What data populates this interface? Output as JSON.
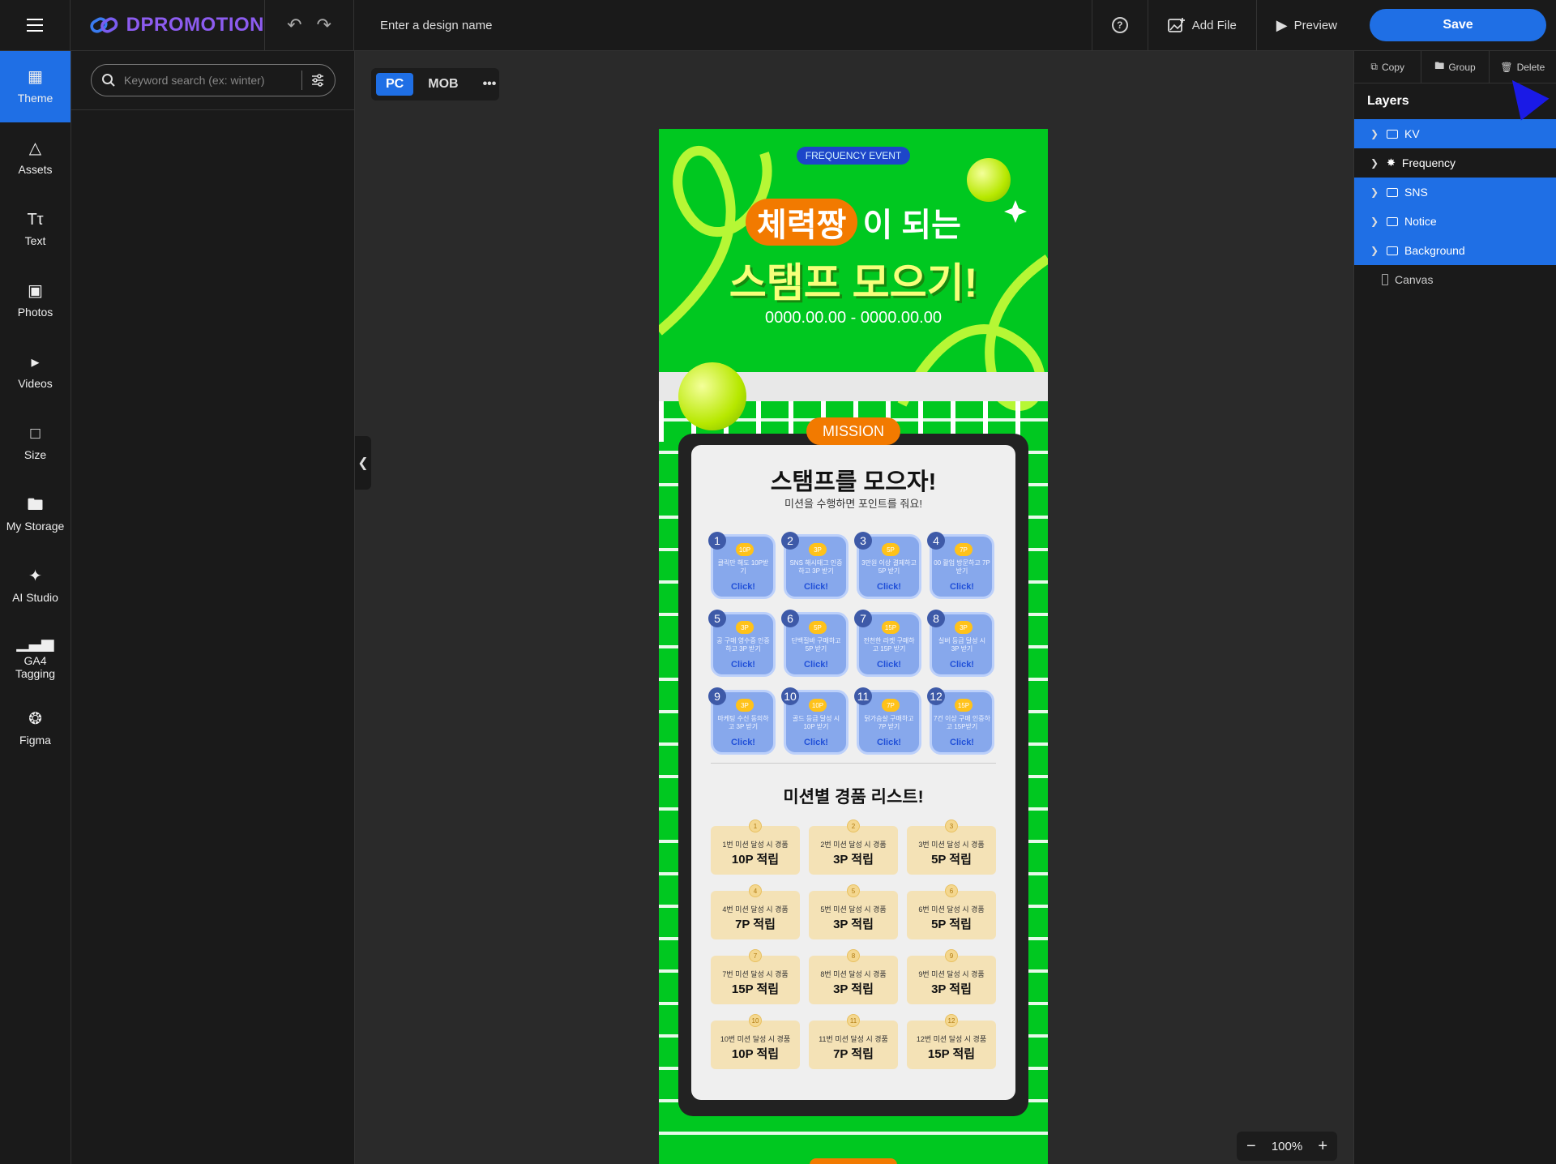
{
  "app": {
    "brand": "DPROMOTION",
    "design_name_placeholder": "Enter a design name"
  },
  "topbar": {
    "add_file": "Add File",
    "preview": "Preview",
    "save": "Save",
    "help_icon": "help-circle-icon"
  },
  "rail": {
    "items": [
      {
        "label": "Theme",
        "icon": "theme-icon",
        "active": true
      },
      {
        "label": "Assets",
        "icon": "assets-icon"
      },
      {
        "label": "Text",
        "icon": "text-icon"
      },
      {
        "label": "Photos",
        "icon": "photos-icon"
      },
      {
        "label": "Videos",
        "icon": "videos-icon"
      },
      {
        "label": "Size",
        "icon": "size-icon"
      },
      {
        "label": "My Storage",
        "icon": "folder-icon"
      },
      {
        "label": "AI Studio",
        "icon": "magic-wand-icon"
      },
      {
        "label": "GA4 Tagging",
        "icon": "bar-chart-icon"
      },
      {
        "label": "Figma",
        "icon": "figma-icon"
      }
    ]
  },
  "panel": {
    "search_placeholder": "Keyword search (ex: winter)"
  },
  "device": {
    "pc": "PC",
    "mob": "MOB"
  },
  "canvas": {
    "badge": "FREQUENCY EVENT",
    "title_highlight": "체력짱",
    "title_rest": "이 되는",
    "title_line2": "스탬프 모으기!",
    "date": "0000.00.00 - 0000.00.00",
    "mission_tag": "MISSION",
    "board_title": "스탬프를 모으자!",
    "board_subtitle": "미션을 수행하면 포인트를 줘요!",
    "stamps": [
      {
        "num": "1",
        "points": "10P",
        "desc": "클릭만 해도 10P받기",
        "click": "Click!"
      },
      {
        "num": "2",
        "points": "3P",
        "desc": "SNS 해시태그 인증하고 3P 받기",
        "click": "Click!"
      },
      {
        "num": "3",
        "points": "5P",
        "desc": "3만원 이상 결제하고 5P 받기",
        "click": "Click!"
      },
      {
        "num": "4",
        "points": "7P",
        "desc": "00 활업 방문하고 7P 받기",
        "click": "Click!"
      },
      {
        "num": "5",
        "points": "3P",
        "desc": "공 구매 영수증 인증하고 3P 받기",
        "click": "Click!"
      },
      {
        "num": "6",
        "points": "5P",
        "desc": "단백질바 구매하고 5P 받기",
        "click": "Click!"
      },
      {
        "num": "7",
        "points": "15P",
        "desc": "전천한 라켓 구매하고 15P 받기",
        "click": "Click!"
      },
      {
        "num": "8",
        "points": "3P",
        "desc": "실버 등급 달성 시 3P 받기",
        "click": "Click!"
      },
      {
        "num": "9",
        "points": "3P",
        "desc": "마케팅 수신 동의하고 3P 받기",
        "click": "Click!"
      },
      {
        "num": "10",
        "points": "10P",
        "desc": "골드 등급 달성 시 10P 받기",
        "click": "Click!"
      },
      {
        "num": "11",
        "points": "7P",
        "desc": "닭가슴살 구매하고 7P 받기",
        "click": "Click!"
      },
      {
        "num": "12",
        "points": "15P",
        "desc": "7건 이상 구매 인증하고 15P받기",
        "click": "Click!"
      }
    ],
    "prize_title": "미션별 경품 리스트!",
    "prizes": [
      {
        "num": "1",
        "cond": "1번 미션 달성 시 경품",
        "reward": "10P 적립"
      },
      {
        "num": "2",
        "cond": "2번 미션 달성 시 경품",
        "reward": "3P 적립"
      },
      {
        "num": "3",
        "cond": "3번 미션 달성 시 경품",
        "reward": "5P 적립"
      },
      {
        "num": "4",
        "cond": "4번 미션 달성 시 경품",
        "reward": "7P 적립"
      },
      {
        "num": "5",
        "cond": "5번 미션 달성 시 경품",
        "reward": "3P 적립"
      },
      {
        "num": "6",
        "cond": "6번 미션 달성 시 경품",
        "reward": "5P 적립"
      },
      {
        "num": "7",
        "cond": "7번 미션 달성 시 경품",
        "reward": "15P 적립"
      },
      {
        "num": "8",
        "cond": "8번 미션 달성 시 경품",
        "reward": "3P 적립"
      },
      {
        "num": "9",
        "cond": "9번 미션 달성 시 경품",
        "reward": "3P 적립"
      },
      {
        "num": "10",
        "cond": "10번 미션 달성 시 경품",
        "reward": "10P 적립"
      },
      {
        "num": "11",
        "cond": "11번 미션 달성 시 경품",
        "reward": "7P 적립"
      },
      {
        "num": "12",
        "cond": "12번 미션 달성 시 경품",
        "reward": "15P 적립"
      }
    ]
  },
  "zoom": {
    "level": "100%"
  },
  "rpanel": {
    "copy": "Copy",
    "group": "Group",
    "delete": "Delete",
    "layers_title": "Layers",
    "layers": [
      {
        "label": "KV",
        "selected": true,
        "type": "folder"
      },
      {
        "label": "Frequency",
        "selected": false,
        "type": "group"
      },
      {
        "label": "SNS",
        "selected": true,
        "type": "folder"
      },
      {
        "label": "Notice",
        "selected": true,
        "type": "folder"
      },
      {
        "label": "Background",
        "selected": true,
        "type": "folder"
      },
      {
        "label": "Canvas",
        "selected": false,
        "type": "canvas"
      }
    ]
  },
  "colors": {
    "accent": "#1f6fe5",
    "canvas_green": "#00c820",
    "orange": "#f27a00",
    "stamp_blue": "#87a8ec"
  }
}
